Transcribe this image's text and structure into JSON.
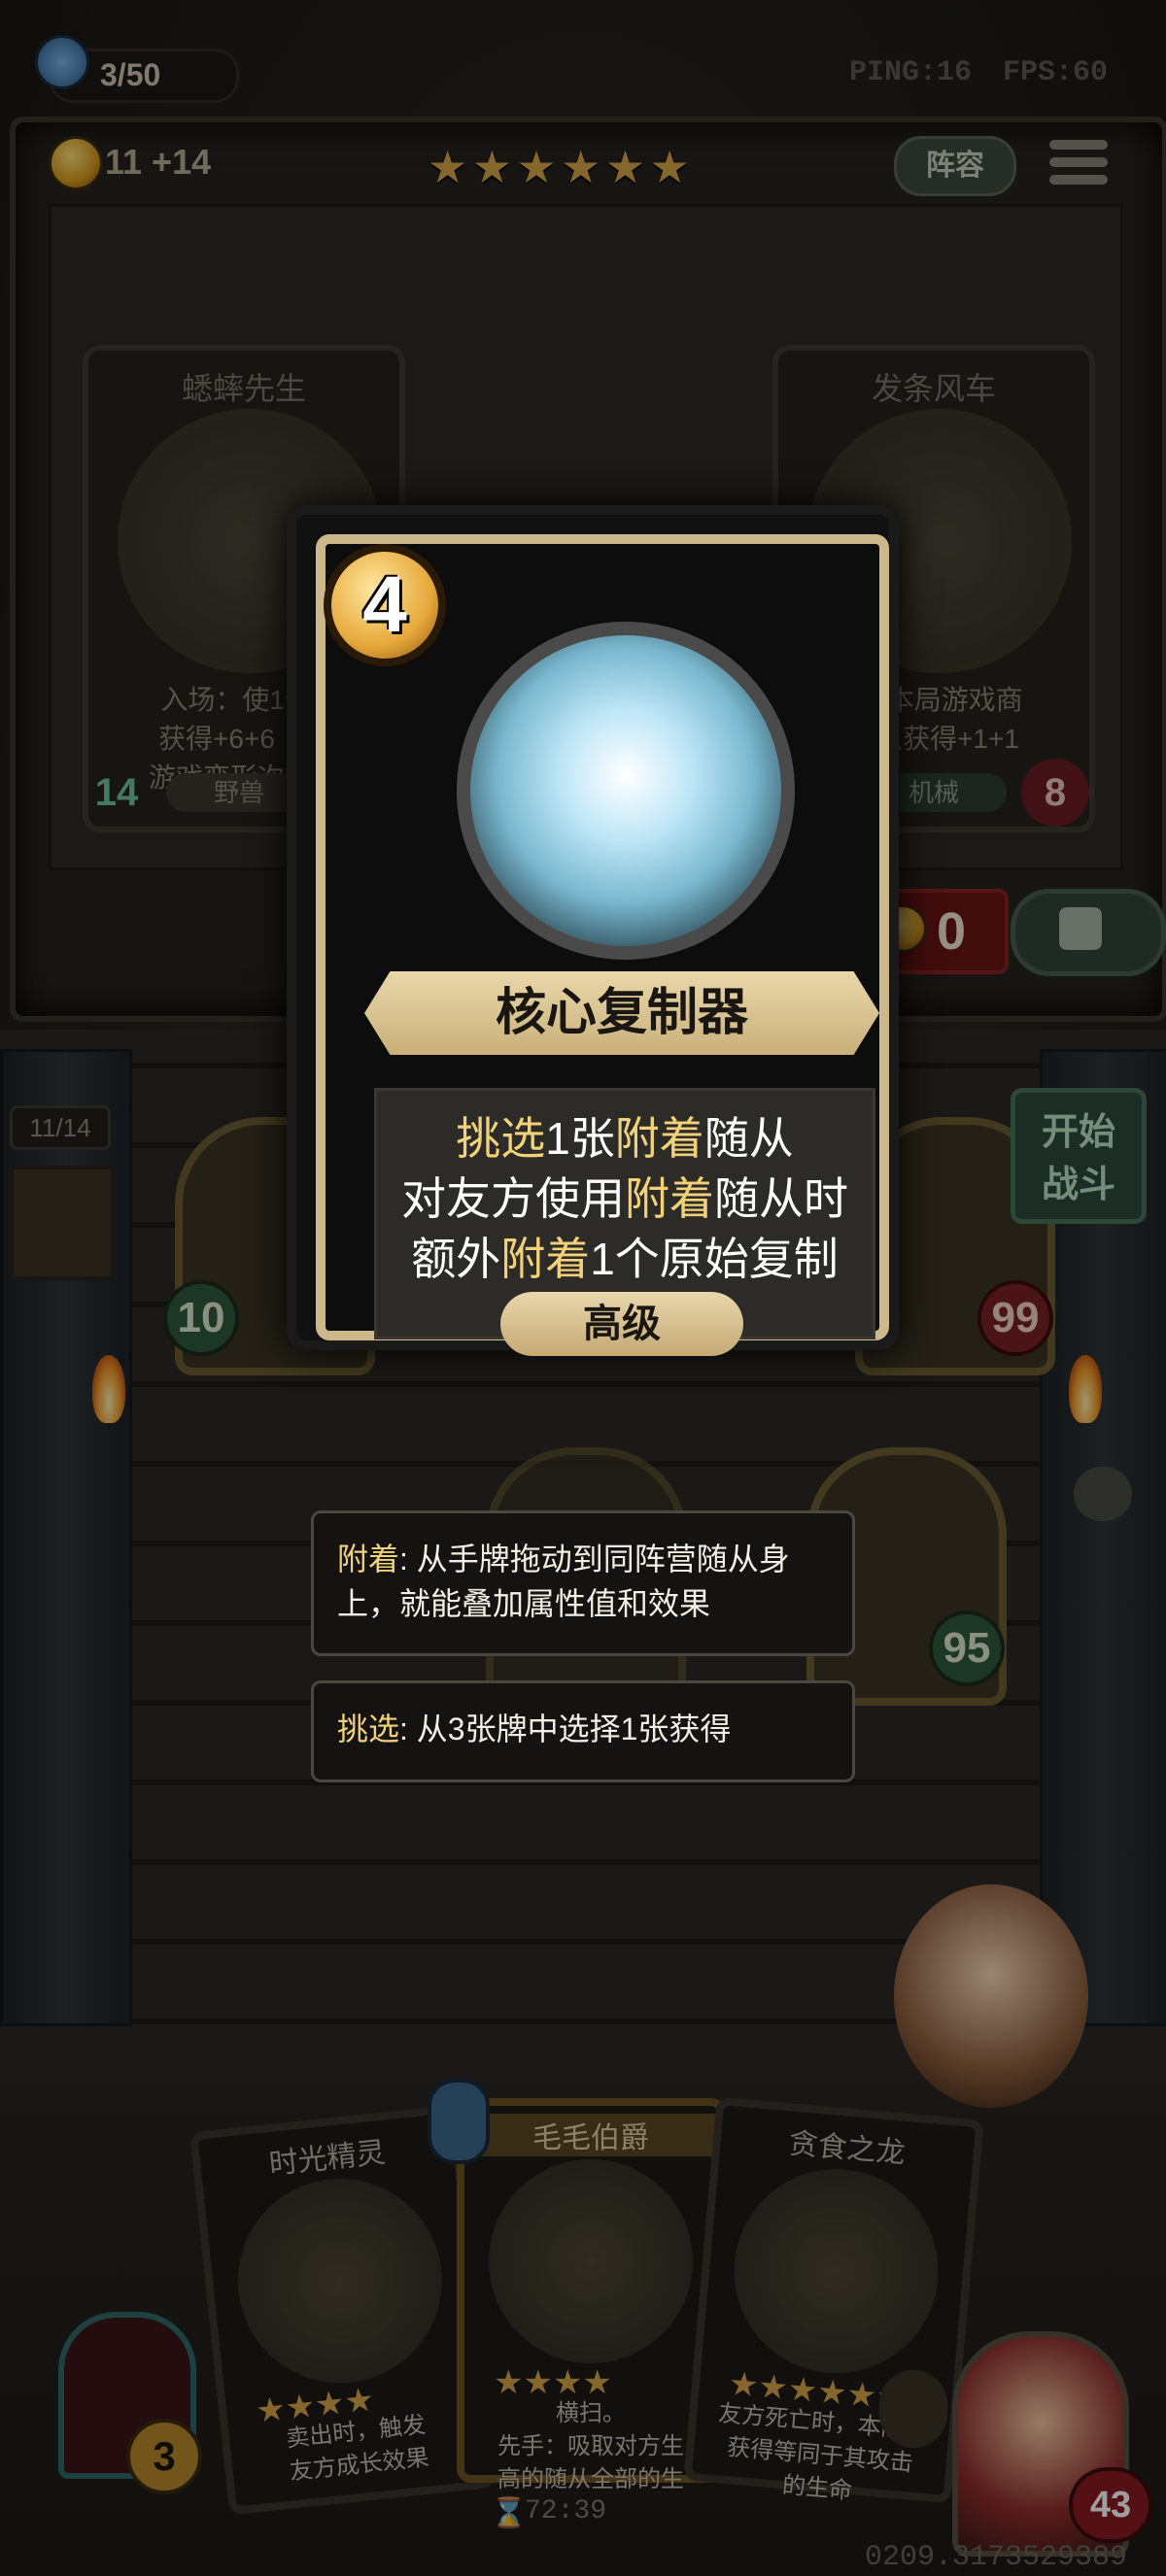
{
  "hud": {
    "population": "3/50",
    "gold": "11 +14",
    "ping": "PING:16",
    "fps": "FPS:60",
    "lineup_label": "阵容",
    "tavern_stars": 6
  },
  "shop": {
    "cards": [
      {
        "name": "蟋蟀先生",
        "desc": "入场：使1个7\n获得+6+6（随\n游戏变形次数提",
        "attack": "14",
        "tag": "野兽"
      },
      {
        "name": "发条风车",
        "desc": "5，本局游戏商\n随从获得+1+1",
        "attack": "8",
        "tag": "机械"
      }
    ],
    "freeze_cost": "0"
  },
  "featured": {
    "cost": "4",
    "name": "核心复制器",
    "line1_a": "挑选",
    "line1_b": "1张",
    "line1_c": "附着",
    "line1_d": "随从",
    "line2_a": "对友方使用",
    "line2_b": "附着",
    "line2_c": "随从时",
    "line3_a": "额外",
    "line3_b": "附着",
    "line3_c": "1个原始复制",
    "rarity": "高级"
  },
  "tooltips": {
    "attach_keyword": "附着",
    "attach_text": ": 从手牌拖动到同阵营随从身上，就能叠加属性值和效果",
    "pick_keyword": "挑选",
    "pick_text": ": 从3张牌中选择1张获得"
  },
  "board": {
    "count": "11/14",
    "minions": [
      {
        "atk": "10"
      },
      {
        "atk": "99"
      },
      {
        "atk": "95"
      }
    ],
    "start_battle": [
      "开始",
      "战斗"
    ]
  },
  "hand": [
    {
      "name": "时光精灵",
      "desc": "卖出时，触发\n友方成长效果"
    },
    {
      "name": "毛毛伯爵",
      "desc": "横扫。\n先手：吸取对方生\n高的随从全部的生"
    },
    {
      "name": "贪食之龙",
      "desc": "友方死亡时，本随从\n获得等同于其攻击\n的生命"
    }
  ],
  "footer": {
    "timer": "72:39",
    "serial": "0209.3173529389",
    "hero_hp": "43",
    "level": "3"
  },
  "colors": {
    "keyword": "#f1d27a",
    "card_trim": "#cdb78c",
    "battle_green": "#49735b"
  }
}
